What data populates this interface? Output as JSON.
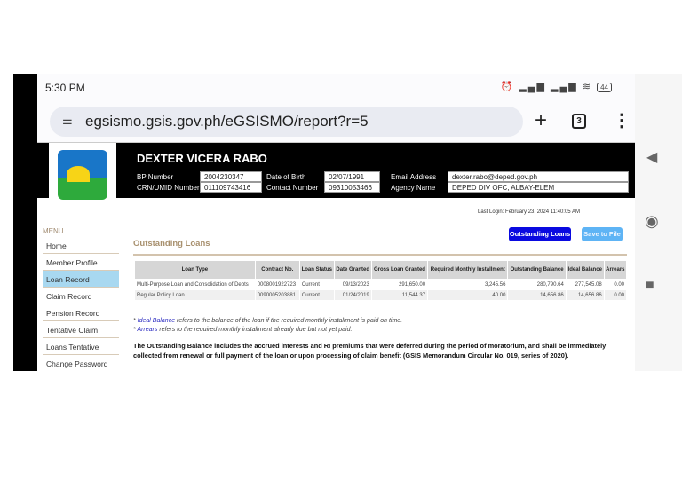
{
  "status": {
    "time": "5:30 PM",
    "battery": "44"
  },
  "browser": {
    "url": "egsismo.gsis.gov.ph/eGSISMO/report?r=5",
    "tab_count": "3"
  },
  "profile": {
    "name": "DEXTER VICERA RABO",
    "fields": [
      {
        "label": "BP Number",
        "value": "2004230347"
      },
      {
        "label": "CRN/UMID Number",
        "value": "011109743416"
      },
      {
        "label": "Date of Birth",
        "value": "02/07/1991"
      },
      {
        "label": "Contact Number",
        "value": "09310053466"
      },
      {
        "label": "Email Address",
        "value": "dexter.rabo@deped.gov.ph"
      },
      {
        "label": "Agency Name",
        "value": "DEPED DIV OFC, ALBAY-ELEM"
      }
    ]
  },
  "last_login": "Last Login: February 23, 2024 11:40:05 AM",
  "menu": {
    "heading": "MENU",
    "items": [
      "Home",
      "Member Profile",
      "Loan Record",
      "Claim Record",
      "Pension Record",
      "Tentative Claim",
      "Loans Tentative",
      "Change Password"
    ],
    "active": "Loan Record"
  },
  "section_title": "Outstanding Loans",
  "buttons": {
    "outstanding": "Outstanding Loans",
    "save": "Save to File"
  },
  "table": {
    "headers": [
      "Loan Type",
      "Contract No.",
      "Loan Status",
      "Date Granted",
      "Gross Loan Granted",
      "Required Monthly Installment",
      "Outstanding Balance",
      "Ideal Balance",
      "Arrears"
    ],
    "rows": [
      [
        "Multi-Purpose Loan and Consolidation of Debts",
        "0008001922723",
        "Current",
        "09/13/2023",
        "291,650.00",
        "3,245.56",
        "280,790.64",
        "277,545.08",
        "0.00"
      ],
      [
        "Regular Policy Loan",
        "0090005203881",
        "Current",
        "01/24/2019",
        "11,544.37",
        "40.00",
        "14,656.86",
        "14,656.86",
        "0.00"
      ]
    ]
  },
  "notes": [
    {
      "term": "Ideal Balance",
      "text": " refers to the balance of the loan if the required monthly installment is paid on time."
    },
    {
      "term": "Arrears",
      "text": " refers to the required monthly installment already due but not yet paid."
    }
  ],
  "disclaimer": "The Outstanding Balance includes the accrued interests and RI premiums that were deferred during the period of moratorium, and shall be immediately collected from renewal or full payment of the loan or upon processing of claim benefit (GSIS Memorandum Circular No. 019, series of 2020)."
}
